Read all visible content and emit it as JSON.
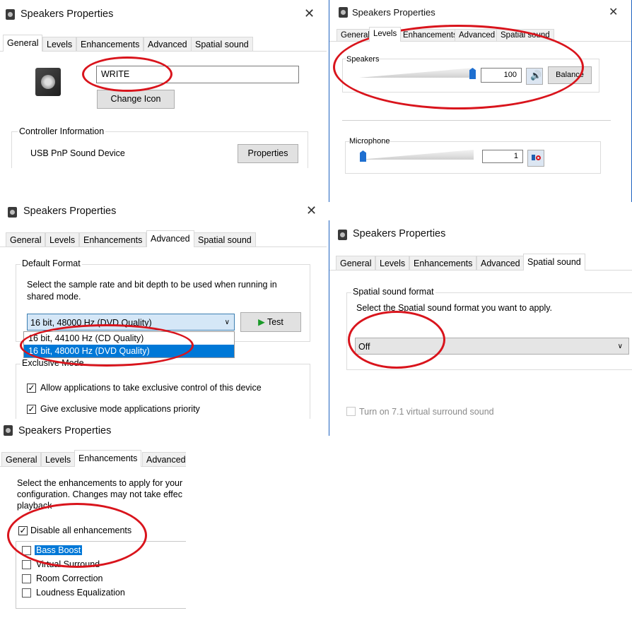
{
  "app_title": "Speakers Properties",
  "tabs": {
    "general": "General",
    "levels": "Levels",
    "enhancements": "Enhancements",
    "advanced": "Advanced",
    "spatial": "Spatial sound"
  },
  "general_panel": {
    "device_name": "WRITE",
    "change_icon_label": "Change Icon",
    "controller_group": "Controller Information",
    "controller_name": "USB PnP Sound Device",
    "properties_label": "Properties"
  },
  "levels_panel": {
    "speakers_label": "Speakers",
    "speakers_value": "100",
    "speakers_level": 1.0,
    "balance_label": "Balance",
    "microphone_label": "Microphone",
    "microphone_value": "1",
    "microphone_level": 0.01
  },
  "advanced_panel": {
    "default_format_group": "Default Format",
    "description": "Select the sample rate and bit depth to be used when running in shared mode.",
    "selected_format": "16 bit, 48000 Hz (DVD Quality)",
    "options": [
      "16 bit, 44100 Hz (CD Quality)",
      "16 bit, 48000 Hz (DVD Quality)"
    ],
    "test_label": "Test",
    "exclusive_group": "Exclusive Mode",
    "allow_exclusive": "Allow applications to take exclusive control of this device",
    "give_priority": "Give exclusive mode applications priority"
  },
  "spatial_panel": {
    "group": "Spatial sound format",
    "instruction": "Select the Spatial sound format you want to apply.",
    "selected": "Off",
    "virtual_surround": "Turn on 7.1 virtual surround sound"
  },
  "enhancements_panel": {
    "description_lines": [
      "Select the enhancements to apply for your",
      "configuration. Changes may not take effec",
      "playback"
    ],
    "disable_all": "Disable all enhancements",
    "items": [
      "Bass Boost",
      "Virtual Surround",
      "Room Correction",
      "Loudness Equalization"
    ]
  },
  "colors": {
    "annotation": "#d9141c",
    "selection": "#0078d7",
    "slider_thumb": "#1e6fd0"
  }
}
